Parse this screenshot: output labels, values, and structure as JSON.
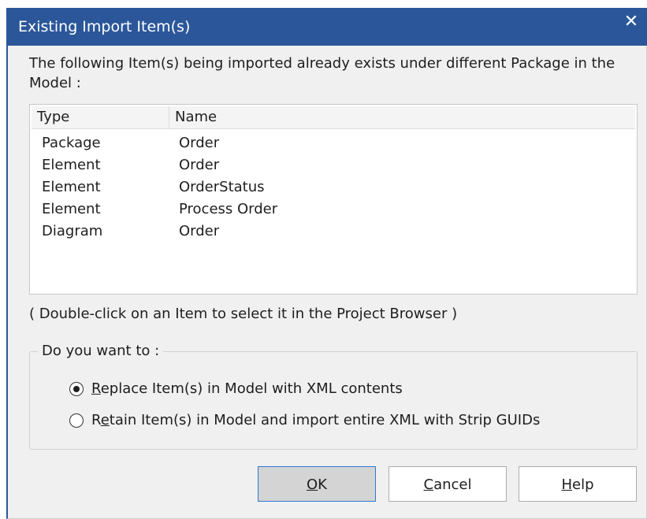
{
  "window": {
    "title": "Existing Import Item(s)",
    "close_glyph": "✕"
  },
  "message": "The following Item(s) being imported already exists under different Package in the Model :",
  "list": {
    "columns": [
      "Type",
      "Name"
    ],
    "rows": [
      {
        "type": "Package",
        "name": "Order"
      },
      {
        "type": "Element",
        "name": "Order"
      },
      {
        "type": "Element",
        "name": "OrderStatus"
      },
      {
        "type": "Element",
        "name": "Process Order"
      },
      {
        "type": "Diagram",
        "name": "Order"
      }
    ]
  },
  "hint": "( Double-click on an Item to select it in the Project Browser )",
  "options": {
    "legend": "Do you want to :",
    "items": [
      {
        "label_mnemonic": "R",
        "label_rest": "eplace Item(s) in Model with XML contents",
        "checked": true
      },
      {
        "label_pre": "R",
        "label_mnemonic": "e",
        "label_rest": "tain Item(s) in Model and import entire XML with Strip GUIDs",
        "checked": false
      }
    ]
  },
  "buttons": {
    "ok": {
      "mnemonic": "O",
      "rest": "K"
    },
    "cancel": {
      "mnemonic": "C",
      "rest": "ancel"
    },
    "help": {
      "mnemonic": "H",
      "rest": "elp"
    }
  },
  "colors": {
    "titlebar": "#2b579a",
    "dialog_bg": "#f0f0f0",
    "default_button_border": "#2b7ad6"
  }
}
